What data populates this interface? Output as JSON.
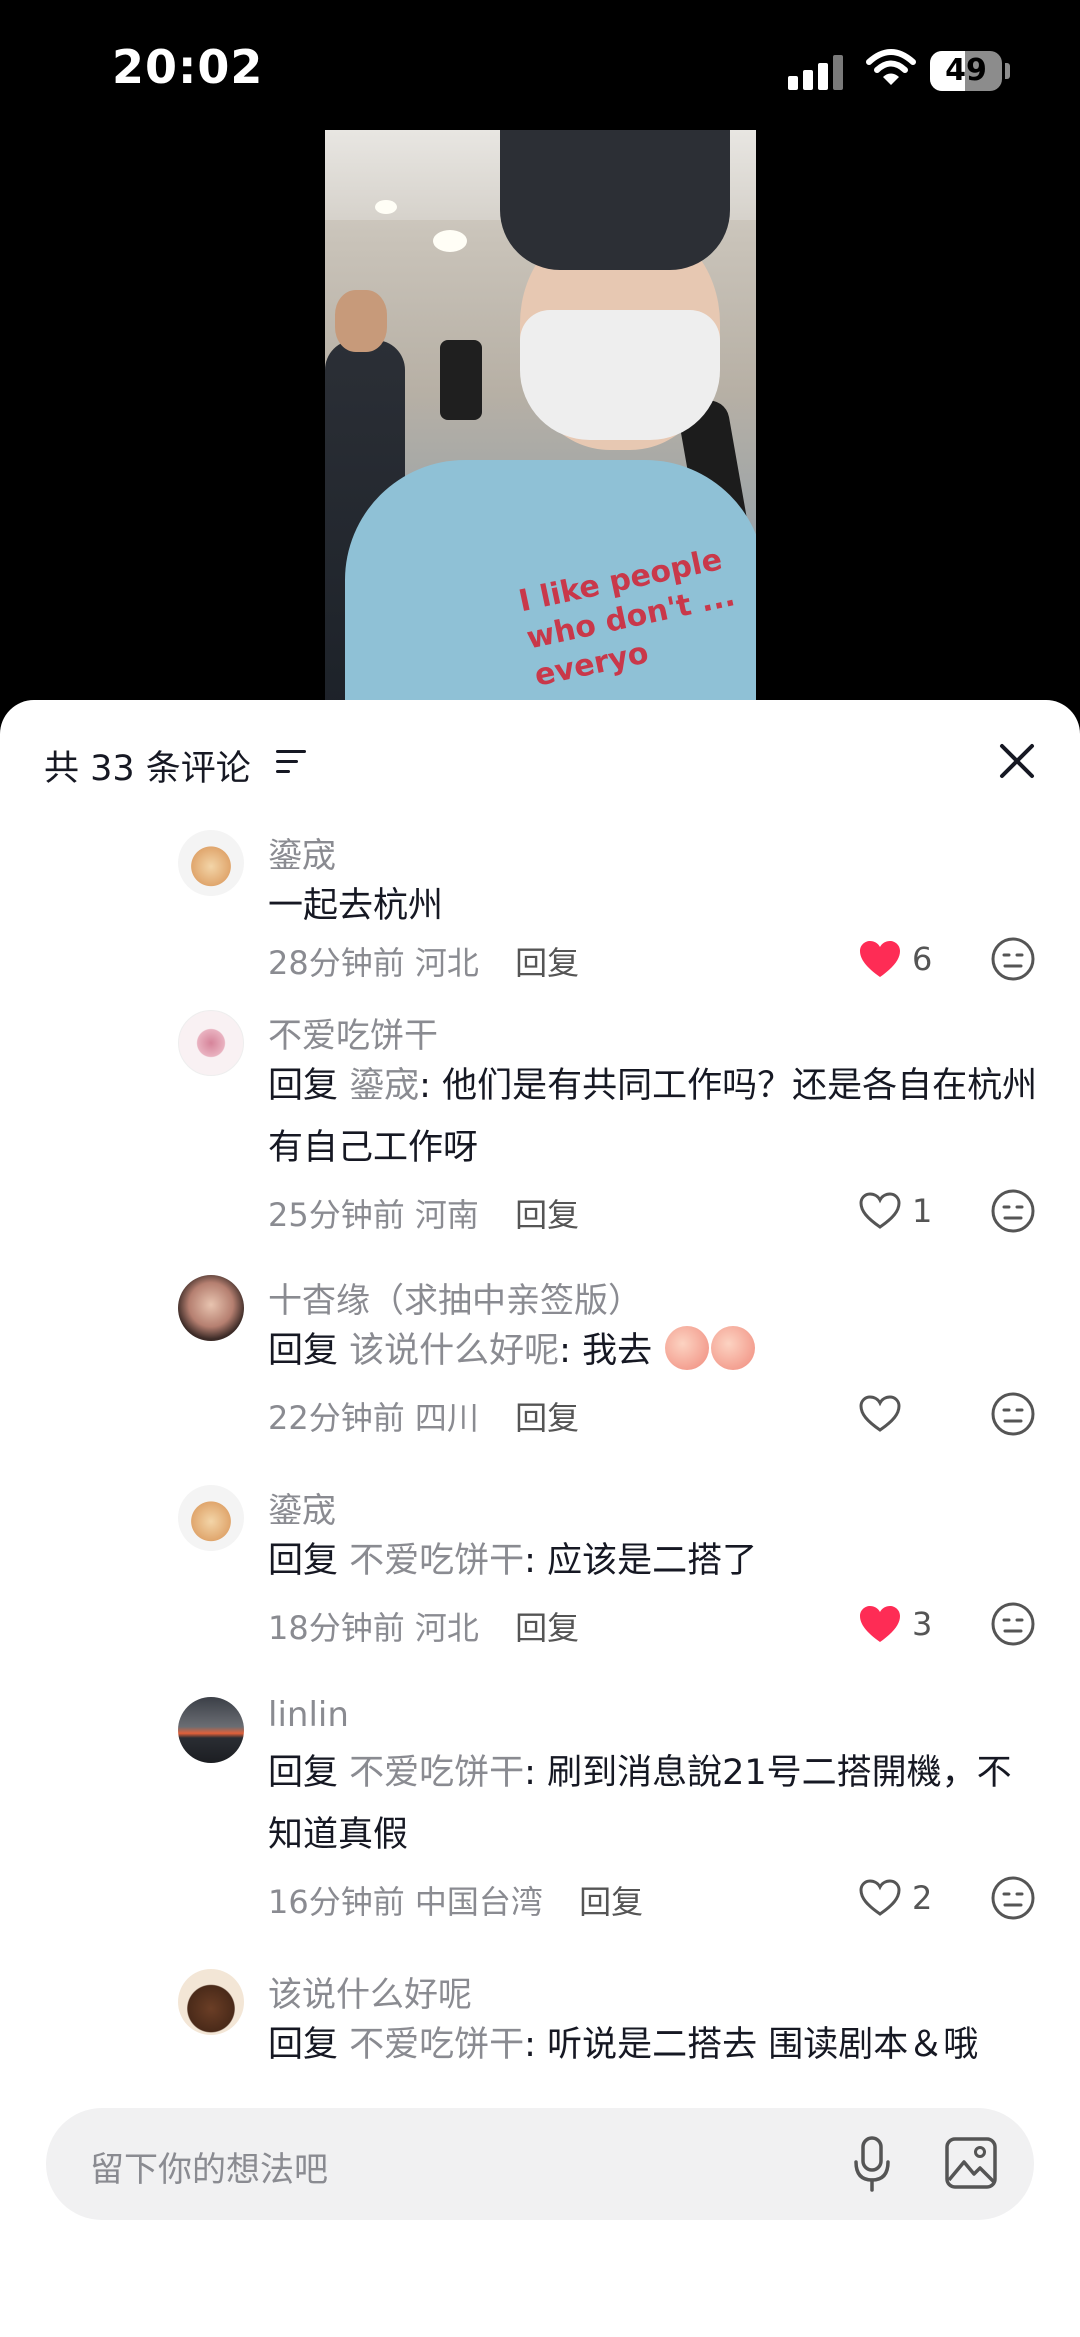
{
  "status_bar": {
    "time": "20:02",
    "battery": "49"
  },
  "video": {
    "shirt_text": "I like people who don't ... everyo"
  },
  "sheet": {
    "comment_count_label": "共 33 条评论",
    "close_icon": "close-icon",
    "sort_icon": "sort-icon"
  },
  "comments": [
    {
      "username": "鎏宬",
      "text": "一起去杭州",
      "time": "28分钟前",
      "location": "河北",
      "reply_label": "回复",
      "likes": "6",
      "liked": true
    },
    {
      "username": "不爱吃饼干",
      "reply_prefix": "回复",
      "mention": "鎏宬",
      "text": ": 他们是有共同工作吗？还是各自在杭州有自己工作呀",
      "time": "25分钟前",
      "location": "河南",
      "reply_label": "回复",
      "likes": "1",
      "liked": false
    },
    {
      "username": "十杳缘（求抽中亲签版）",
      "reply_prefix": "回复",
      "mention": "该说什么好呢",
      "text": ": 我去",
      "time": "22分钟前",
      "location": "四川",
      "reply_label": "回复",
      "likes": "",
      "liked": false
    },
    {
      "username": "鎏宬",
      "reply_prefix": "回复",
      "mention": "不爱吃饼干",
      "text": ": 应该是二搭了",
      "time": "18分钟前",
      "location": "河北",
      "reply_label": "回复",
      "likes": "3",
      "liked": true
    },
    {
      "username": "linlin",
      "reply_prefix": "回复",
      "mention": "不爱吃饼干",
      "text": ": 刷到消息說21号二搭開機，不知道真假",
      "time": "16分钟前",
      "location": "中国台湾",
      "reply_label": "回复",
      "likes": "2",
      "liked": false
    },
    {
      "username": "该说什么好呢",
      "reply_prefix": "回复",
      "mention": "不爱吃饼干",
      "text": ": 听说是二搭去 围读剧本＆哦",
      "time": "",
      "location": "",
      "reply_label": "",
      "likes": "",
      "liked": false
    }
  ],
  "input": {
    "placeholder": "留下你的想法吧",
    "mic_icon": "mic-icon",
    "image_icon": "image-icon"
  },
  "colors": {
    "liked_heart": "#fe2c55",
    "muted_text": "#8a8b91",
    "primary_text": "#161823"
  }
}
